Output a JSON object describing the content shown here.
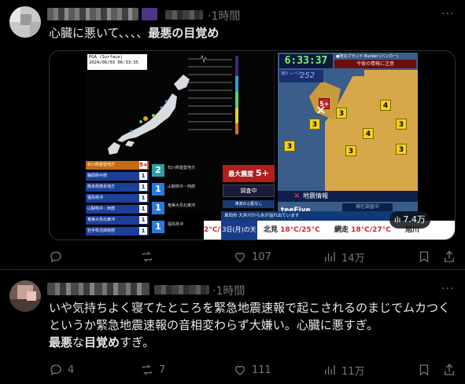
{
  "post1": {
    "time": "1時間",
    "text_normal": "心臓に悪いて、、、、",
    "text_bold": "最悪の目覚め",
    "media": {
      "pga_line1": "PGA (Surface)",
      "pga_line2": "2024/06/03 06:33:35",
      "clock": "6:33:37",
      "bunker_label": "●既災ブランド Bunker (バンカー)",
      "warning": "今後の情報に注意",
      "level_label": "揺れ\nレベル",
      "level_value": "252",
      "shindo_title": "最大震度",
      "shindo_value": "5+",
      "chosa": "調査中",
      "tsunami": "津波の心配なし",
      "jishin_label": "地震情報",
      "genzai": "現在調査中",
      "teefive": "teeFive",
      "ticker": "島田市 大井川から水が溢れ出ています",
      "weather_day": "3日(月)の天気",
      "left_temp": "2°C/7°C",
      "weather": [
        {
          "city": "北見",
          "temp": "18°C/25°C"
        },
        {
          "city": "網走",
          "temp": "18°C/27°C"
        },
        {
          "city": "旭川",
          "temp": ""
        }
      ],
      "quake_list": [
        {
          "area": "石川県能登地方",
          "num": "5+",
          "color": "#c66a13"
        },
        {
          "area": "静岡県中部",
          "num": "1",
          "color": "#1c3f9c"
        },
        {
          "area": "熊本県熊本地方",
          "num": "1",
          "color": "#1c3f9c"
        },
        {
          "area": "福島県沖",
          "num": "1",
          "color": "#1c3f9c"
        },
        {
          "area": "山梨県中・西部",
          "num": "1",
          "color": "#1c3f9c"
        },
        {
          "area": "奄美大島北東沖",
          "num": "1",
          "color": "#1c3f9c"
        },
        {
          "area": "岩手県沿岸南部",
          "num": "1",
          "color": "#1c3f9c"
        }
      ],
      "quake_list2": [
        {
          "num": "2",
          "text": "石川県能登地方"
        },
        {
          "num": "1",
          "text": "山梨県中・西部"
        },
        {
          "num": "1",
          "text": "奄美大島北東沖"
        },
        {
          "num": "1",
          "text": "福島県沖"
        }
      ],
      "view_badge": "7.4万"
    },
    "actions": {
      "reply": "",
      "repost": "",
      "like": "107",
      "views": "14万"
    }
  },
  "post2": {
    "time": "1時間",
    "line1": "いや気持ちよく寝てたところを緊急地震速報で起こされるのまじでムカつく",
    "line2_a": "というか緊急地震速報",
    "line2_b": "の音相変わらず大嫌い。心臓に悪すぎ。",
    "line3_a": "最悪",
    "line3_b": "な",
    "line3_c": "目覚め",
    "line3_d": "すぎ。",
    "actions": {
      "reply": "4",
      "repost": "7",
      "like": "111",
      "views": "11万"
    }
  },
  "colors": {
    "background": "#000000",
    "text": "#e7e9ea",
    "muted": "#71767b",
    "divider": "#2f3336"
  },
  "icons": [
    "more-icon",
    "reply-icon",
    "repost-icon",
    "like-icon",
    "views-icon",
    "bookmark-icon",
    "share-icon"
  ]
}
